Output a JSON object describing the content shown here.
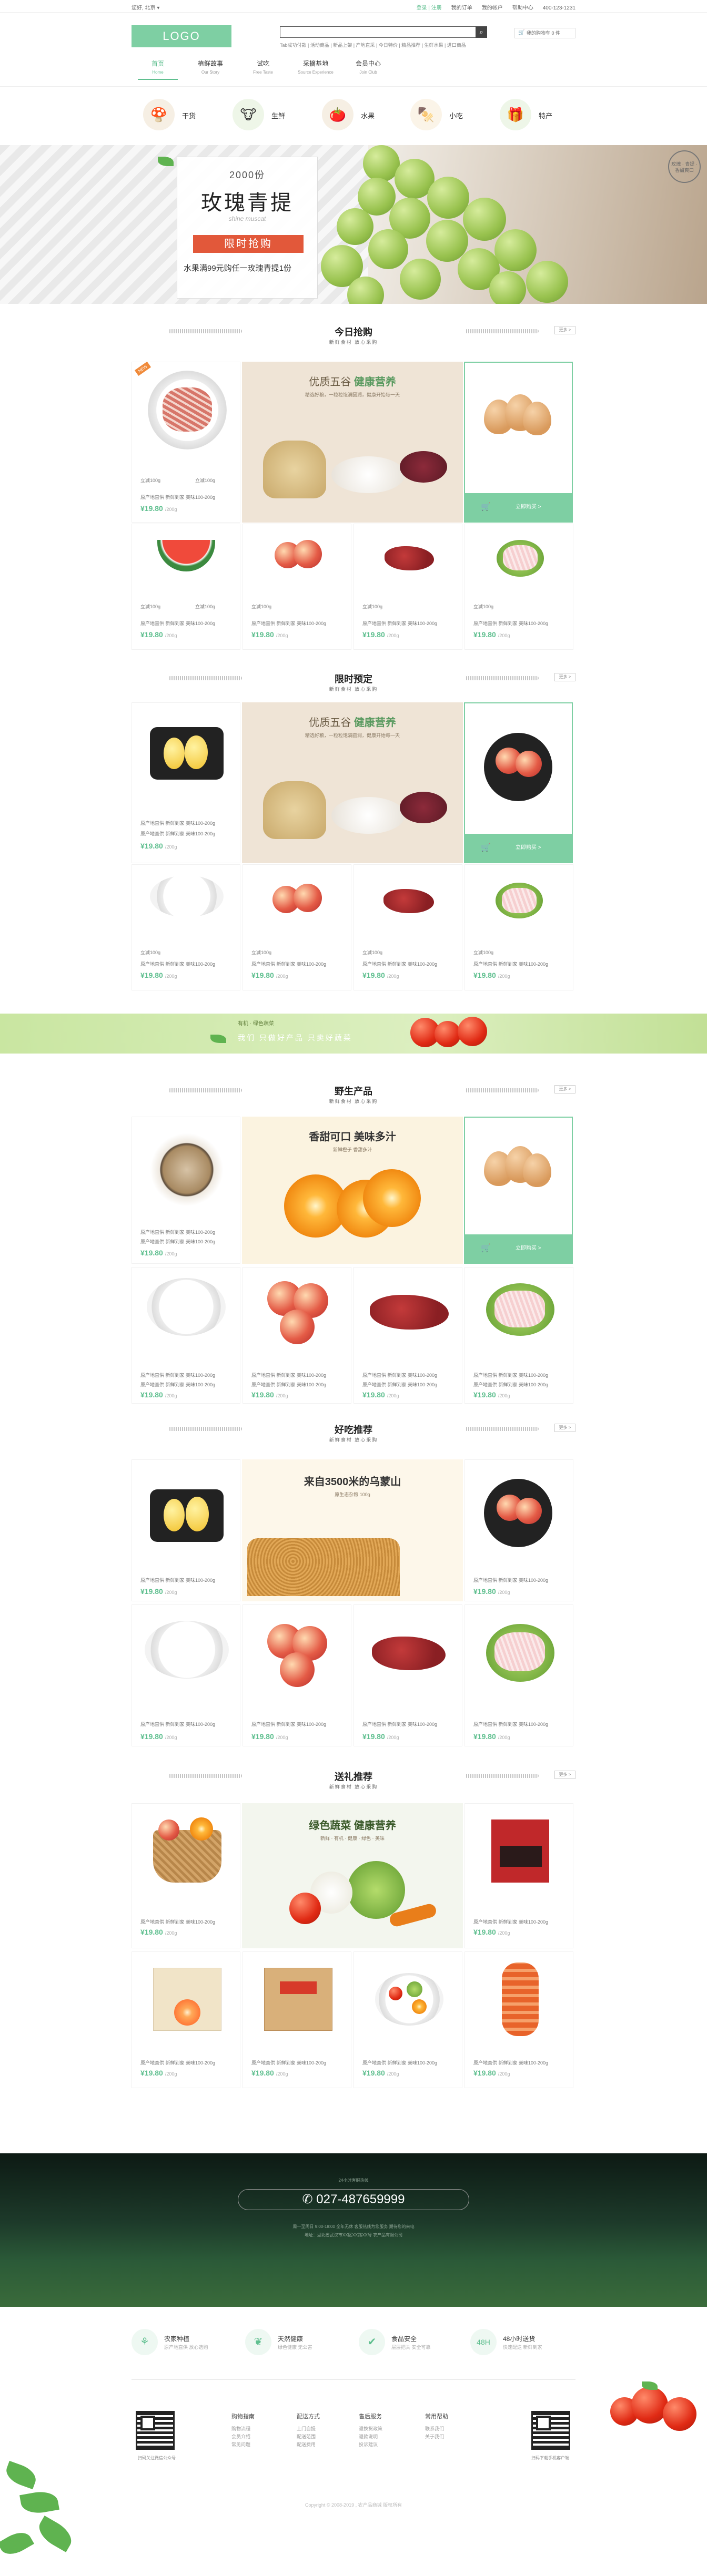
{
  "topbar": {
    "left": "您好, 北京 ▾",
    "right": [
      "登录 | 注册",
      "我的订单",
      "我的帐户",
      "帮助中心",
      "400-123-1231"
    ]
  },
  "header": {
    "logo": "LOGO",
    "search_btn": "⌕",
    "hot": "Tab成功付款 | 活动商品 | 新品上架 | 产地直采 | 今日特价 | 精品推荐 | 生鲜水果 | 进口商品",
    "cart": "我的购物车 0 件"
  },
  "nav": [
    {
      "t": "首页",
      "s": "Home"
    },
    {
      "t": "植鲜故事",
      "s": "Our Story"
    },
    {
      "t": "试吃",
      "s": "Free Taste"
    },
    {
      "t": "采摘基地",
      "s": "Source Experience"
    },
    {
      "t": "会员中心",
      "s": "Join Club"
    }
  ],
  "cats": [
    "干货",
    "生鲜",
    "水果",
    "小吃",
    "特产"
  ],
  "banner": {
    "num": "2000份",
    "title": "玫瑰青提",
    "cursive": "shine muscat",
    "btn": "限时抢购",
    "sub": "水果满99元购任一玫瑰青提1份",
    "seal": "玫瑰 · 青提 · 香甜爽口"
  },
  "sections": {
    "s1": {
      "title": "今日抢购",
      "sub": "新鲜食材 放心采购",
      "more": "更多 >"
    },
    "s2": {
      "title": "限时预定",
      "sub": "新鲜食材 放心采购",
      "more": "更多 >"
    },
    "s3": {
      "title": "野生产品",
      "sub": "新鲜食材 放心采购",
      "more": "更多 >"
    },
    "s4": {
      "title": "好吃推荐",
      "sub": "新鲜食材 放心采购",
      "more": "更多 >"
    },
    "s5": {
      "title": "送礼推荐",
      "sub": "新鲜食材 放心采购",
      "more": "更多 >"
    }
  },
  "promo1": {
    "title_a": "优质五谷",
    "title_b": "健康营养",
    "sub": "精选好粮，一粒粒饱满圆润，健康开始每一天"
  },
  "promo3": {
    "title": "香甜可口 美味多汁",
    "sub": "新鲜橙子 香甜多汁"
  },
  "promo4": {
    "title": "来自3500米的乌蒙山",
    "sub": "原生态杂粮 100g"
  },
  "promo5": {
    "title": "绿色蔬菜 健康营养",
    "sub": "新鲜 · 有机 · 健康 · 绿色 · 美味"
  },
  "side_btn": "立即购买 >",
  "prod": {
    "label": "原产地直供 新鲜到家 美味100-200g",
    "price": "¥19.80",
    "unit": "/200g",
    "mini": "立减100g"
  },
  "badge": "NEW",
  "strip": {
    "t1": "有机 · 绿色蔬菜",
    "t2": "我们 只做好产品 只卖好蔬菜"
  },
  "footer": {
    "cap1": "24小时客服热线",
    "phone": "027-487659999",
    "cap2": "周一至周日 9:00-18:00 全年无休 客服热线为您服务 期待您的来电",
    "cap3": "地址：湖北省武汉市XX区XX路XX号 农产品有限公司",
    "features": [
      {
        "ic": "⚘",
        "a": "农家种植",
        "b": "原产地直供 放心选购"
      },
      {
        "ic": "❦",
        "a": "天然健康",
        "b": "绿色健康 无公害"
      },
      {
        "ic": "✔",
        "a": "食品安全",
        "b": "层层把关 安全可靠"
      },
      {
        "ic": "48H",
        "a": "48小时送货",
        "b": "快速配送 新鲜到家"
      }
    ],
    "cols": [
      {
        "h": "购物指南",
        "items": [
          "购物流程",
          "会员介绍",
          "常见问题"
        ]
      },
      {
        "h": "配送方式",
        "items": [
          "上门自提",
          "配送范围",
          "配送费用"
        ]
      },
      {
        "h": "售后服务",
        "items": [
          "退换货政策",
          "退款说明",
          "投诉建议"
        ]
      },
      {
        "h": "常用帮助",
        "items": [
          "联系我们",
          "关于我们"
        ]
      }
    ],
    "qr_l": "扫码关注微信公众号",
    "qr_r": "扫码下载手机客户端",
    "copy": "Copyright © 2008-2019 , 农产品商城 版权所有"
  },
  "colors": {
    "accent": "#7ecfa3",
    "price": "#5fbf8f",
    "banner_btn": "#e2583a"
  }
}
